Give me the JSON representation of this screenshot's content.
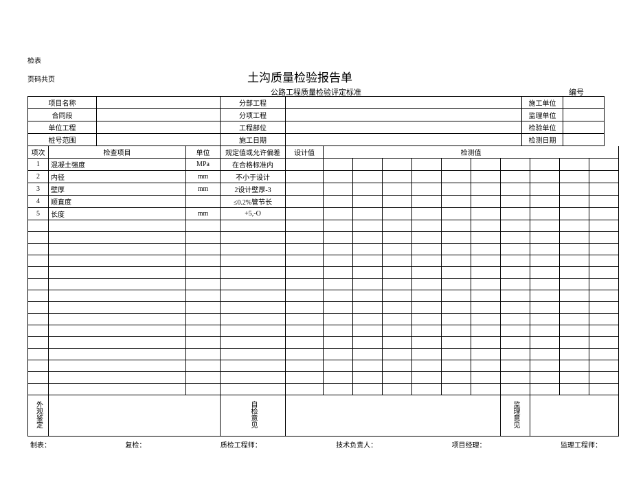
{
  "labels": {
    "check_table": "检表",
    "page_of": "页码共页",
    "title": "土沟质量检验报告单",
    "subtitle": "公路工程质量检验评定标准",
    "doc_no_label": "编号"
  },
  "header": {
    "project_name_lbl": "项目名称",
    "subdiv_lbl": "分部工程",
    "construct_unit_lbl": "施工单位",
    "contract_lbl": "合同段",
    "subitem_lbl": "分项工程",
    "supervise_unit_lbl": "监理单位",
    "unit_proj_lbl": "单位工程",
    "part_lbl": "工程部位",
    "inspect_unit_lbl": "检验单位",
    "pile_range_lbl": "桩号范围",
    "date_lbl": "施工日期",
    "detect_date_lbl": "检测日期"
  },
  "columns": {
    "seq": "项次",
    "item": "检查项目",
    "unit": "单位",
    "spec": "规定值或允许偏差",
    "design": "设计值",
    "measured": "检测值"
  },
  "rows": [
    {
      "seq": "1",
      "item": "混凝土强度",
      "unit": "MPa",
      "spec": "在合格标准内"
    },
    {
      "seq": "2",
      "item": "内径",
      "unit": "mm",
      "spec": "不小于设计"
    },
    {
      "seq": "3",
      "item": "壁厚",
      "unit": "mm",
      "spec": "2设计壁厚-3"
    },
    {
      "seq": "4",
      "item": "顺直度",
      "unit": "",
      "spec": "≤0.2%管节长"
    },
    {
      "seq": "5",
      "item": "长度",
      "unit": "mm",
      "spec": "+5,-O"
    }
  ],
  "blank_rows": 15,
  "opinion": {
    "appearance": "外观鉴定",
    "self_check": "自检意见",
    "supervise": "监理意见"
  },
  "signoff": {
    "tabulate": "制表：",
    "recheck": "复检：",
    "qc_eng": "质检工程师：",
    "tech_lead": "技术负责人：",
    "pm": "项目经理：",
    "sup_eng": "监理工程师："
  }
}
